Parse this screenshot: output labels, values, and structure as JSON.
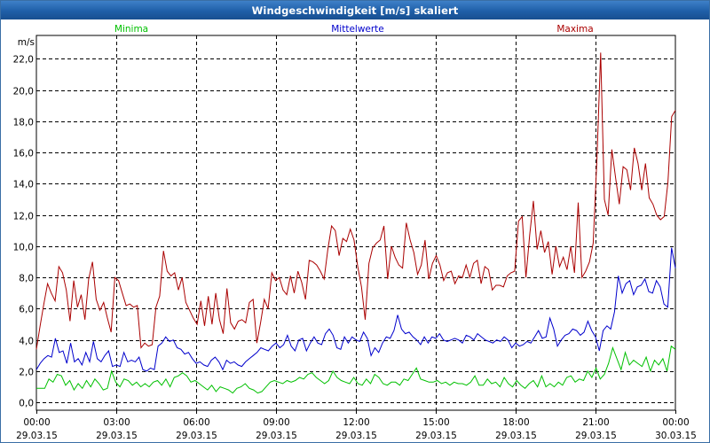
{
  "window": {
    "title": "Windgeschwindigkeit [m/s] skaliert"
  },
  "chart_data": {
    "type": "line",
    "title": "Windgeschwindigkeit [m/s] skaliert",
    "ylabel": "m/s",
    "xlabel": "",
    "ylim": [
      -0.5,
      23.5
    ],
    "y_ticks": [
      "0,0",
      "2,0",
      "4,0",
      "6,0",
      "8,0",
      "10,0",
      "12,0",
      "14,0",
      "16,0",
      "18,0",
      "20,0",
      "22,0"
    ],
    "y_tick_values": [
      0,
      2,
      4,
      6,
      8,
      10,
      12,
      14,
      16,
      18,
      20,
      22
    ],
    "x_range_hours": [
      0,
      24
    ],
    "x_ticks": [
      {
        "time": "00:00",
        "date": "29.03.15"
      },
      {
        "time": "03:00",
        "date": "29.03.15"
      },
      {
        "time": "06:00",
        "date": "29.03.15"
      },
      {
        "time": "09:00",
        "date": "29.03.15"
      },
      {
        "time": "12:00",
        "date": "29.03.15"
      },
      {
        "time": "15:00",
        "date": "29.03.15"
      },
      {
        "time": "18:00",
        "date": "29.03.15"
      },
      {
        "time": "21:00",
        "date": "29.03.15"
      },
      {
        "time": "00:00",
        "date": "30.03.15"
      }
    ],
    "grid": true,
    "legend_position": "top",
    "series": [
      {
        "name": "Minima",
        "color": "#00c000",
        "values": [
          0.9,
          0.9,
          0.9,
          1.5,
          1.3,
          1.8,
          1.7,
          1.1,
          1.4,
          0.8,
          1.2,
          0.9,
          1.4,
          1.0,
          1.5,
          1.2,
          0.8,
          0.9,
          2.0,
          1.3,
          1.0,
          1.5,
          1.4,
          1.1,
          1.3,
          1.0,
          1.2,
          1.0,
          1.3,
          1.4,
          1.1,
          1.5,
          1.0,
          1.6,
          1.7,
          1.9,
          1.7,
          1.3,
          1.4,
          1.2,
          1.0,
          0.8,
          1.1,
          0.7,
          1.0,
          0.9,
          0.8,
          0.6,
          0.9,
          1.0,
          1.2,
          0.9,
          0.8,
          0.6,
          0.7,
          1.0,
          1.3,
          1.4,
          1.3,
          1.2,
          1.4,
          1.3,
          1.4,
          1.6,
          1.5,
          1.8,
          1.9,
          1.6,
          1.4,
          1.2,
          1.4,
          2.0,
          1.6,
          1.4,
          1.3,
          1.2,
          1.6,
          1.2,
          1.1,
          1.5,
          1.2,
          1.8,
          1.6,
          1.2,
          1.1,
          1.3,
          1.3,
          1.1,
          1.5,
          1.4,
          1.8,
          2.2,
          1.5,
          1.4,
          1.3,
          1.3,
          1.4,
          1.2,
          1.3,
          1.1,
          1.3,
          1.2,
          1.2,
          1.1,
          1.3,
          1.7,
          1.1,
          1.1,
          1.5,
          1.2,
          1.3,
          1.0,
          1.6,
          1.2,
          1.0,
          1.4,
          1.1,
          0.9,
          1.2,
          1.4,
          1.0,
          1.7,
          1.0,
          1.2,
          1.0,
          1.3,
          1.1,
          1.6,
          1.7,
          1.3,
          1.5,
          1.4,
          2.0,
          1.6,
          2.2,
          1.5,
          1.8,
          2.5,
          3.5,
          2.8,
          2.1,
          3.2,
          2.4,
          2.7,
          2.5,
          2.3,
          2.9,
          2.0,
          2.7,
          2.4,
          2.8,
          2.0,
          3.6,
          3.4
        ]
      },
      {
        "name": "Mittelwerte",
        "color": "#0000cc",
        "values": [
          2.1,
          2.5,
          2.8,
          3.0,
          2.9,
          4.1,
          3.2,
          3.3,
          2.5,
          3.8,
          2.6,
          2.8,
          2.4,
          3.2,
          2.6,
          3.9,
          2.8,
          2.6,
          3.0,
          3.3,
          2.3,
          2.4,
          2.3,
          3.2,
          2.6,
          2.7,
          2.6,
          2.9,
          2.1,
          2.0,
          2.2,
          2.1,
          3.6,
          3.8,
          4.2,
          3.9,
          4.0,
          3.5,
          3.4,
          3.1,
          3.2,
          2.8,
          2.5,
          2.6,
          2.4,
          2.3,
          2.7,
          2.9,
          2.6,
          2.1,
          2.7,
          2.5,
          2.6,
          2.4,
          2.3,
          2.6,
          2.8,
          3.0,
          3.2,
          3.5,
          3.4,
          3.3,
          3.6,
          3.8,
          3.5,
          3.7,
          4.3,
          3.6,
          3.3,
          4.0,
          4.1,
          3.3,
          3.8,
          4.2,
          3.8,
          3.7,
          4.4,
          4.7,
          4.3,
          3.5,
          3.4,
          4.2,
          3.8,
          4.2,
          4.0,
          3.9,
          4.5,
          4.1,
          3.0,
          3.5,
          3.2,
          3.8,
          4.2,
          4.1,
          4.6,
          5.6,
          4.7,
          4.4,
          4.5,
          4.2,
          4.0,
          3.7,
          4.2,
          3.8,
          4.2,
          4.1,
          4.4,
          4.0,
          3.9,
          4.0,
          4.1,
          4.0,
          3.8,
          4.3,
          4.2,
          4.0,
          4.4,
          4.2,
          4.0,
          3.9,
          3.8,
          4.0,
          3.9,
          4.2,
          4.0,
          3.5,
          3.8,
          3.6,
          3.7,
          3.9,
          3.8,
          4.2,
          4.6,
          4.1,
          4.2,
          5.4,
          4.7,
          3.6,
          4.0,
          4.3,
          4.4,
          4.7,
          4.6,
          4.3,
          4.5,
          5.2,
          4.6,
          4.2,
          3.3,
          4.6,
          4.9,
          4.7,
          5.8,
          8.1,
          7.0,
          7.6,
          7.8,
          6.9,
          7.4,
          7.5,
          7.9,
          7.1,
          7.0,
          7.8,
          7.4,
          6.3,
          6.1,
          9.9,
          8.6
        ]
      },
      {
        "name": "Maxima",
        "color": "#aa0000",
        "values": [
          3.4,
          4.9,
          6.3,
          7.6,
          7.0,
          6.5,
          8.7,
          8.3,
          7.2,
          5.2,
          7.8,
          6.1,
          6.9,
          5.3,
          7.9,
          9.0,
          6.6,
          5.9,
          6.4,
          5.4,
          4.5,
          8.0,
          7.8,
          7.0,
          6.2,
          6.3,
          6.1,
          6.2,
          3.5,
          3.8,
          3.6,
          3.7,
          6.1,
          6.8,
          9.7,
          8.4,
          8.1,
          8.3,
          7.2,
          8.0,
          6.4,
          5.9,
          5.4,
          5.0,
          6.5,
          4.9,
          6.8,
          5.0,
          7.0,
          5.3,
          4.4,
          7.3,
          5.1,
          4.7,
          5.2,
          5.3,
          5.1,
          6.4,
          6.6,
          3.8,
          5.1,
          6.6,
          6.0,
          8.3,
          7.8,
          8.0,
          7.2,
          6.9,
          8.1,
          7.0,
          8.4,
          7.7,
          6.6,
          9.1,
          9.0,
          8.8,
          8.4,
          7.9,
          9.8,
          11.3,
          11.0,
          9.4,
          10.5,
          10.3,
          11.1,
          10.4,
          8.7,
          7.4,
          5.3,
          8.9,
          9.9,
          10.2,
          10.4,
          11.3,
          7.9,
          10.0,
          9.3,
          8.8,
          8.6,
          11.5,
          10.4,
          9.6,
          8.2,
          8.8,
          10.4,
          7.9,
          8.9,
          9.4,
          8.8,
          7.8,
          8.3,
          8.4,
          7.6,
          8.1,
          8.0,
          8.8,
          8.0,
          8.9,
          9.1,
          7.6,
          8.7,
          8.5,
          7.2,
          7.5,
          7.5,
          7.4,
          8.1,
          8.3,
          8.4,
          11.6,
          11.9,
          8.0,
          10.7,
          12.9,
          9.8,
          11.0,
          9.6,
          10.3,
          8.2,
          10.0,
          8.7,
          9.3,
          8.5,
          10.0,
          8.3,
          12.8,
          8.0,
          8.4,
          9.0,
          10.2,
          15.6,
          22.4,
          13.0,
          12.0,
          16.2,
          14.4,
          12.7,
          15.1,
          14.9,
          13.6,
          16.3,
          15.3,
          13.6,
          15.3,
          13.1,
          12.7,
          12.0,
          11.7,
          11.9,
          14.1,
          18.3,
          18.7
        ]
      }
    ]
  }
}
